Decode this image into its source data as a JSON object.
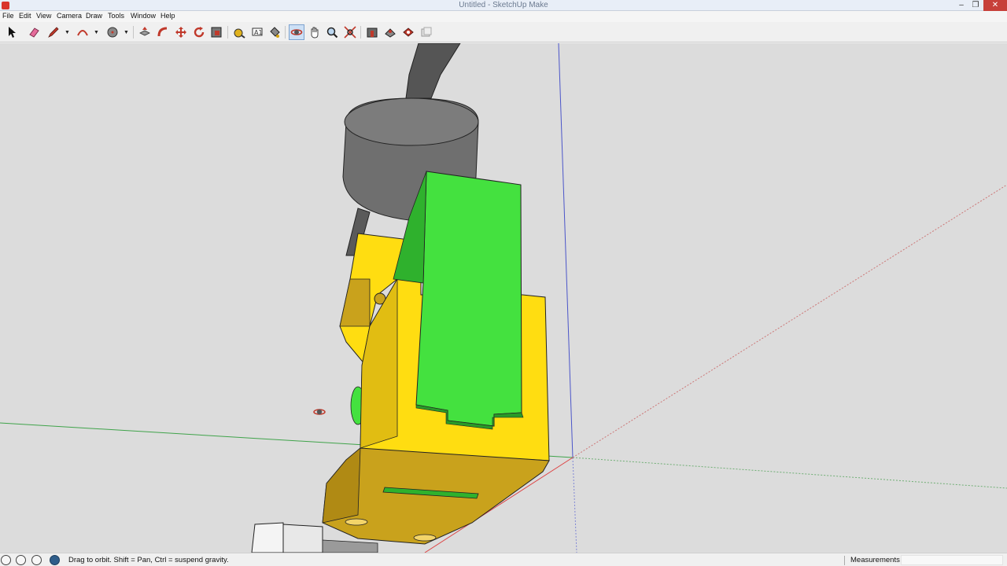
{
  "window": {
    "title": "Untitled - SketchUp Make",
    "controls": [
      "minimize",
      "restore",
      "close"
    ]
  },
  "menu": [
    "File",
    "Edit",
    "View",
    "Camera",
    "Draw",
    "Tools",
    "Window",
    "Help"
  ],
  "toolbar": {
    "tools": [
      {
        "name": "select-tool",
        "icon": "arrow-cursor-icon"
      },
      {
        "name": "eraser-tool",
        "icon": "eraser-icon"
      },
      {
        "name": "line-tool",
        "icon": "pencil-icon"
      },
      {
        "name": "arc-tool",
        "icon": "arc-icon"
      },
      {
        "name": "circle-tool",
        "icon": "circle-icon"
      },
      {
        "name": "push-pull-tool",
        "icon": "push-pull-icon"
      },
      {
        "name": "follow-me-tool",
        "icon": "follow-me-icon"
      },
      {
        "name": "move-tool",
        "icon": "move-icon"
      },
      {
        "name": "rotate-tool",
        "icon": "rotate-icon"
      },
      {
        "name": "scale-tool",
        "icon": "scale-icon"
      },
      {
        "name": "tape-measure-tool",
        "icon": "tape-measure-icon"
      },
      {
        "name": "text-tool",
        "icon": "text-icon"
      },
      {
        "name": "paint-bucket-tool",
        "icon": "paint-bucket-icon"
      },
      {
        "name": "orbit-tool",
        "icon": "orbit-icon",
        "active": true
      },
      {
        "name": "pan-tool",
        "icon": "hand-icon"
      },
      {
        "name": "zoom-tool",
        "icon": "zoom-icon"
      },
      {
        "name": "zoom-extents-tool",
        "icon": "zoom-extents-icon"
      },
      {
        "name": "warehouse-tool",
        "icon": "warehouse-icon"
      },
      {
        "name": "share-model-tool",
        "icon": "share-model-icon"
      },
      {
        "name": "extension-warehouse-tool",
        "icon": "extension-icon"
      },
      {
        "name": "layout-tool",
        "icon": "layout-icon"
      }
    ]
  },
  "status": {
    "hint": "Drag to orbit. Shift = Pan, Ctrl = suspend gravity.",
    "measurements_label": "Measurements",
    "measurements_value": ""
  },
  "colors": {
    "viewport_bg": "#dcdcdc",
    "yellow_face": "#ffdd11",
    "yellow_shade": "#c9a21c",
    "green_face": "#44e13f",
    "green_shade": "#2fb12d",
    "gray_motor": "#6f6f6f",
    "axis_red": "#d44",
    "axis_green": "#3fa34a",
    "axis_blue": "#4b55c9"
  }
}
